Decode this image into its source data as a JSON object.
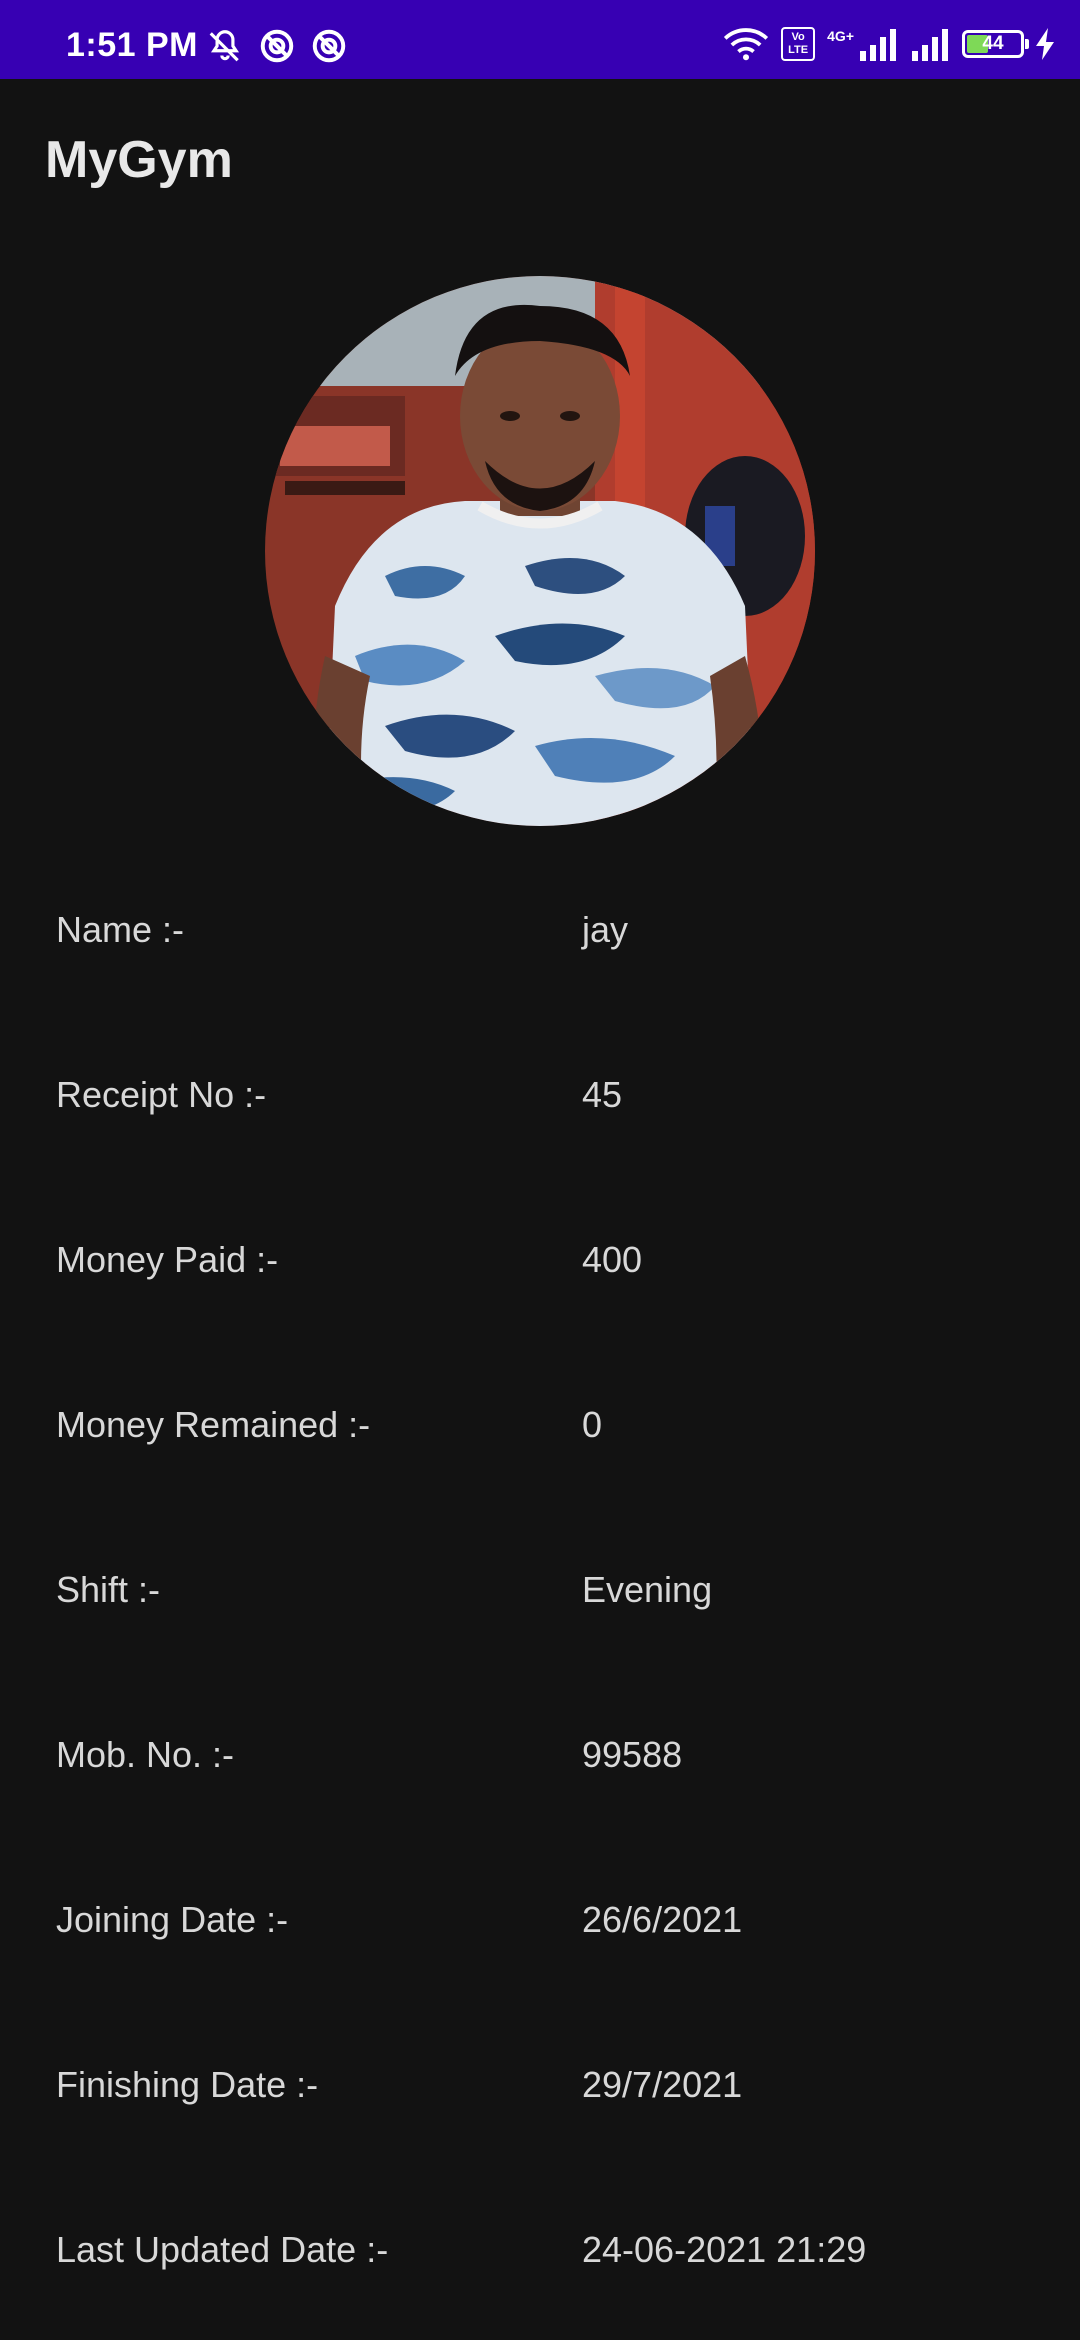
{
  "status_bar": {
    "time": "1:51 PM",
    "volte_label": "Vo LTE",
    "network_label": "4G+",
    "battery_level": "44",
    "battery_percent": 44,
    "background_color": "#3700B3",
    "icons": [
      "mute-bell-icon",
      "sync-off-icon",
      "sync-off-icon",
      "wifi-icon",
      "volte-icon",
      "signal-icon",
      "signal-icon",
      "battery-icon",
      "charging-icon"
    ]
  },
  "app": {
    "title": "MyGym"
  },
  "profile": {
    "photo_alt": "member-photo"
  },
  "details": [
    {
      "label": "Name :-",
      "value": "jay"
    },
    {
      "label": "Receipt No :-",
      "value": "45"
    },
    {
      "label": "Money Paid :-",
      "value": "400"
    },
    {
      "label": "Money Remained :-",
      "value": "0"
    },
    {
      "label": "Shift :-",
      "value": "Evening"
    },
    {
      "label": "Mob. No. :-",
      "value": "99588"
    },
    {
      "label": "Joining Date :-",
      "value": "26/6/2021"
    },
    {
      "label": "Finishing Date :-",
      "value": "29/7/2021"
    },
    {
      "label": "Last Updated Date :-",
      "value": "24-06-2021 21:29"
    }
  ]
}
